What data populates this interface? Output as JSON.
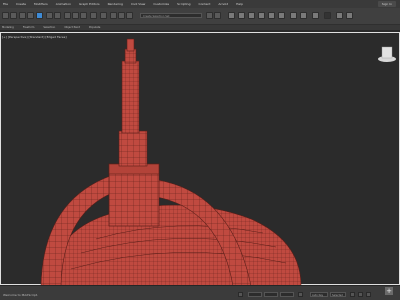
{
  "menu": {
    "items": [
      "File",
      "Create",
      "Modifiers",
      "Animation",
      "Graph Editors",
      "Rendering",
      "Civil View",
      "Customize",
      "Scripting",
      "Content",
      "Arnold",
      "Help"
    ],
    "signin": "Sign In"
  },
  "toolbar": {
    "selection_set": "Create Selection Set"
  },
  "ribbon": {
    "tabs": [
      "Modeling",
      "Freeform",
      "Selection",
      "Object Paint",
      "Populate"
    ]
  },
  "viewport": {
    "label": "[+] [Perspective] [Standard] [Edged Faces]",
    "model_color": "#c04a40",
    "wire_color": "#5a1e18",
    "background": "#2b2b2b"
  },
  "status": {
    "text": "Welcome to MAXScript.",
    "frame": "0 / 100",
    "auto_key": "Auto Key",
    "selected": "Selected",
    "set_key": "Set Key",
    "key_filters": "Key Filters..."
  }
}
